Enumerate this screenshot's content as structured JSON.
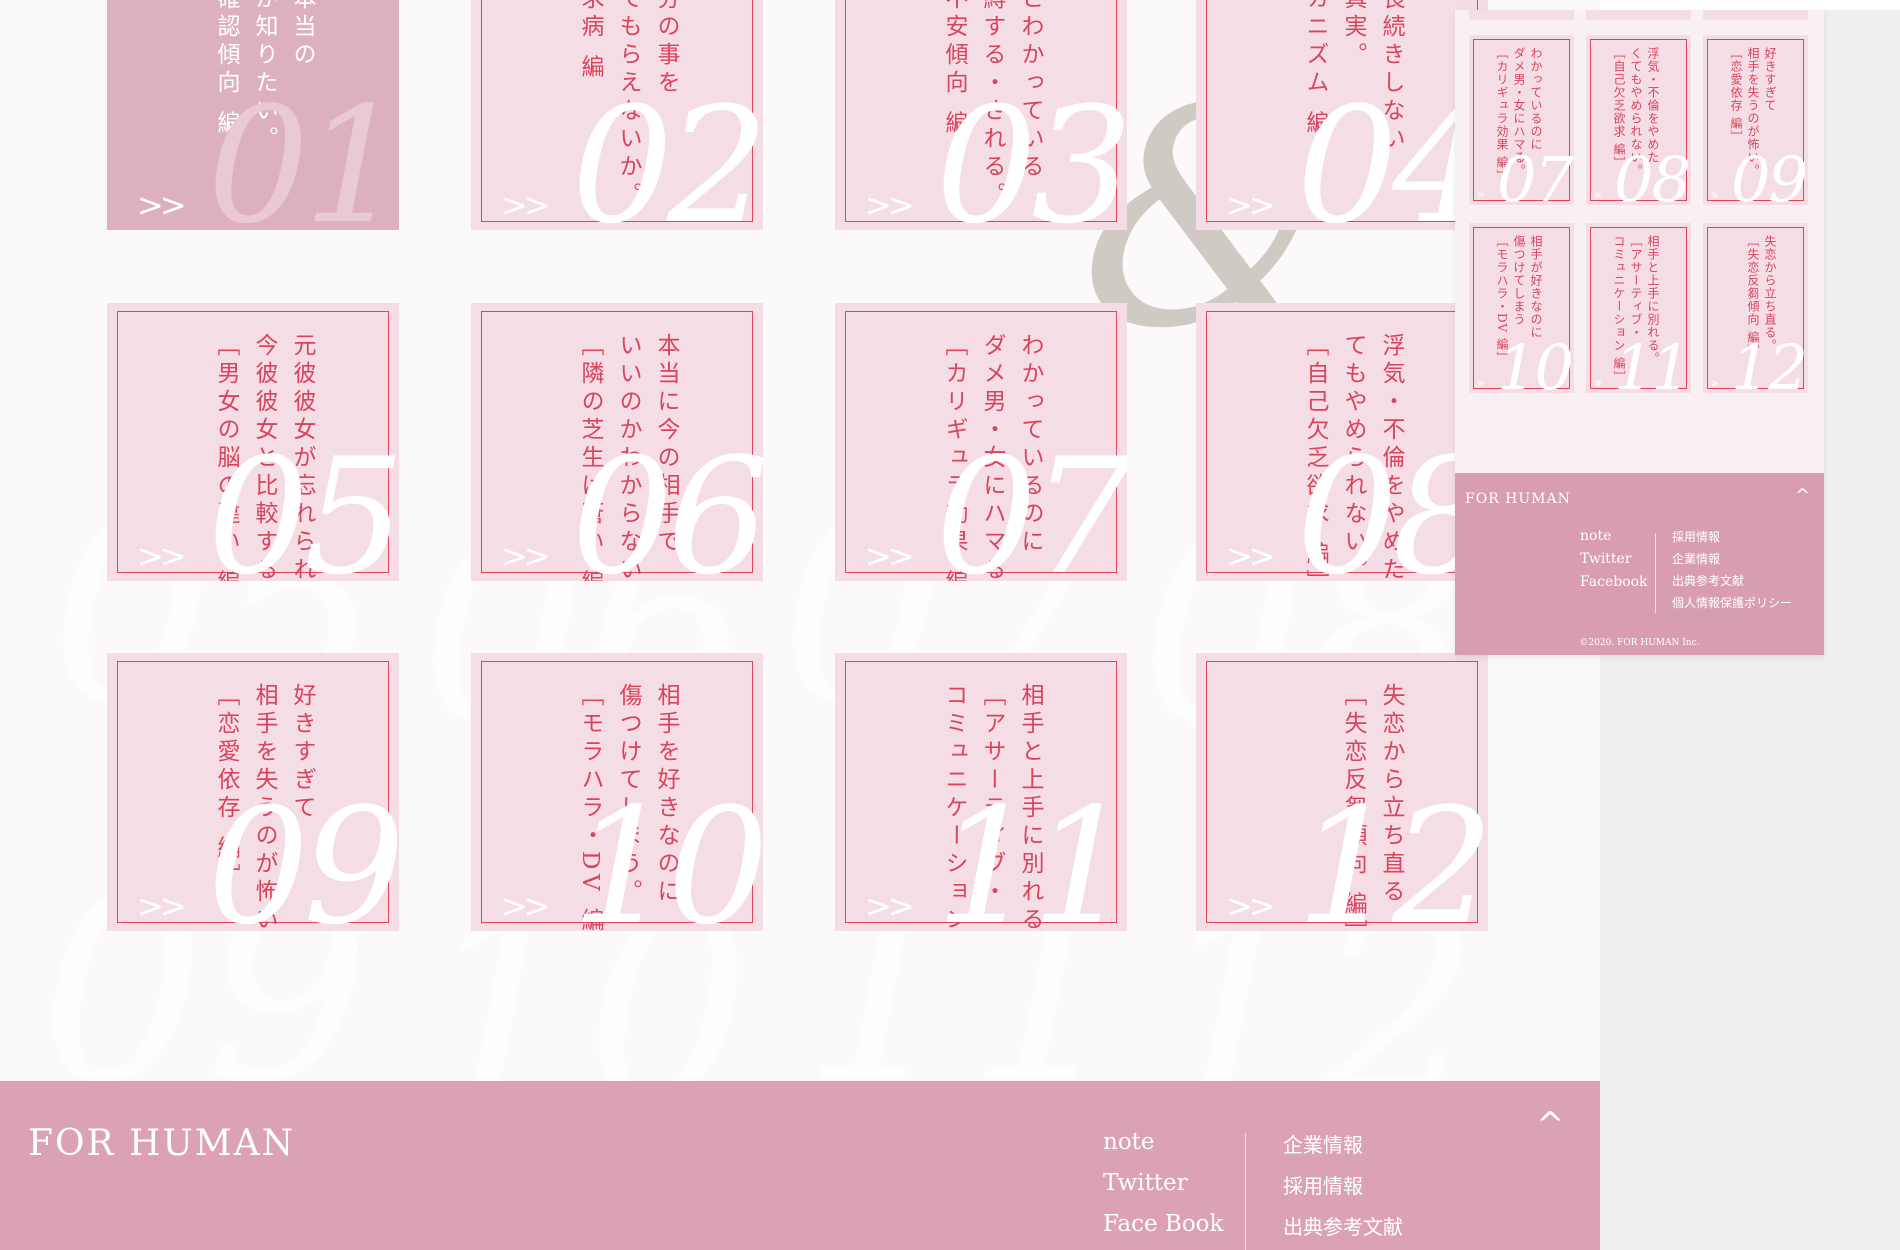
{
  "colors": {
    "page_bg": "#fbf9f9",
    "card_bg": "#f5dde6",
    "card_active_bg": "#ddb0c0",
    "accent_red": "#e0445c",
    "footer_bg": "#dba2b4",
    "number_white": "#ffffff"
  },
  "cards": [
    {
      "num": "01",
      "arrows": ">>",
      "text": "手の本当の\nモチが知りたい。\nの再確認傾向 編"
    },
    {
      "num": "02",
      "arrows": ">>",
      "text": "せ自分の事を\nかってもらえないか。\n認欲求病 編"
    },
    {
      "num": "03",
      "arrows": ">>",
      "text": "メだとわかっている\nに束縛する・される。\n存・不安傾向 編"
    },
    {
      "num": "04",
      "arrows": ">>",
      "text": "際が長続きしない\n撃の真実。\n愛メカニズム 編"
    },
    {
      "num": "05",
      "arrows": ">>",
      "text": "元彼彼女が忘れられず\n今彼彼女と比較する。\n［男女の脳の違い 編］"
    },
    {
      "num": "06",
      "arrows": ">>",
      "text": "本当に今の相手で\nいいのかわからない。\n［隣の芝生は蒼い 編］"
    },
    {
      "num": "07",
      "arrows": ">>",
      "text": "わかっているのに\nダメ男・女にハマる。\n［カリギュラ効果 編］"
    },
    {
      "num": "08",
      "arrows": ">>",
      "text": "浮気・不倫をやめたく\nてもやめられない。\n［自己欠乏欲求 編］"
    },
    {
      "num": "09",
      "arrows": ">>",
      "text": "好きすぎて\n相手を失うのが怖い。\n［恋愛依存 編］"
    },
    {
      "num": "10",
      "arrows": ">>",
      "text": "相手を好きなのに\n傷つけてしまう。\n［モラハラ・DV 編］"
    },
    {
      "num": "11",
      "arrows": ">>",
      "text": "相手と上手に別れる。\n［アサーティブ・\nコミュニケーション 編］"
    },
    {
      "num": "12",
      "arrows": ">>",
      "text": "失恋から立ち直る。\n［失恋反芻傾向 編］"
    }
  ],
  "background": {
    "ghost_numbers": [
      "01",
      "02",
      "03",
      "04",
      "05",
      "06",
      "07",
      "08",
      "09",
      "10",
      "11",
      "12"
    ],
    "ampersand": "&"
  },
  "footer": {
    "brand": "FOR HUMAN",
    "up_icon": "^",
    "links_left": [
      "note",
      "Twitter",
      "Face Book"
    ],
    "links_right": [
      "企業情報",
      "採用情報",
      "出典参考文献"
    ]
  },
  "mini_preview": {
    "cards": [
      {
        "num": "07",
        "text": "わかっているのに\nダメ男・女にハマる。\n［カリギュラ効果 編］"
      },
      {
        "num": "08",
        "text": "浮気・不倫をやめた\nくてもやめられない。\n［自己欠乏欲求 編］"
      },
      {
        "num": "09",
        "text": "好きすぎて\n相手を失うのが怖い。\n［恋愛依存 編］"
      },
      {
        "num": "10",
        "text": "相手が好きなのに\n傷つけてしまう\n［モラハラ・DV 編］"
      },
      {
        "num": "11",
        "text": "相手と上手に別れる。\n［アサーティブ・\nコミュニケーション 編］"
      },
      {
        "num": "12",
        "text": "失恋から立ち直る。\n［失恋反芻傾向 編］"
      }
    ],
    "footer": {
      "brand": "FOR HUMAN",
      "up_icon": "^",
      "links_left": [
        "note",
        "Twitter",
        "Facebook"
      ],
      "links_right": [
        "採用情報",
        "企業情報",
        "出典参考文献",
        "個人情報保護ポリシー"
      ],
      "copyright": "©2020. FOR HUMAN Inc."
    }
  }
}
